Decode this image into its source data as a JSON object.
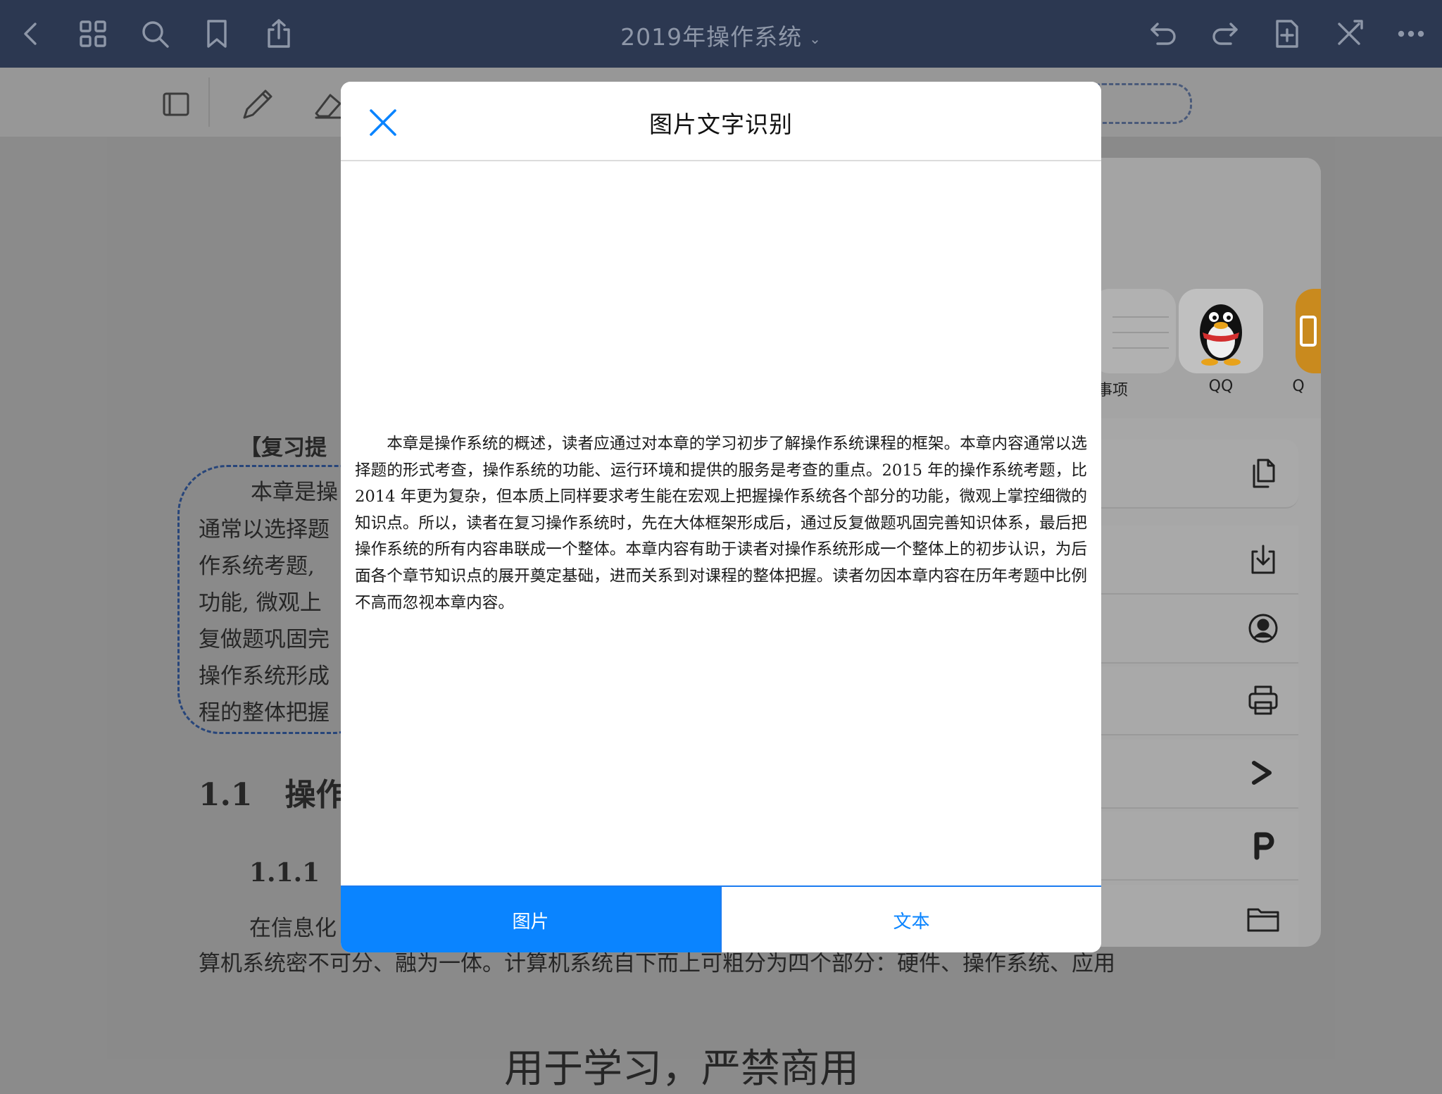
{
  "topbar": {
    "title": "2019年操作系统",
    "icons": [
      "chevron-left-icon",
      "grid-icon",
      "search-icon",
      "bookmark-icon",
      "share-icon",
      "undo-icon",
      "redo-icon",
      "add-page-icon",
      "close-tools-icon",
      "more-icon"
    ]
  },
  "toolbar": {
    "tools": [
      "page-layout-icon",
      "pencil-icon",
      "eraser-icon"
    ]
  },
  "document": {
    "heading_prompt": "【复习提",
    "lines": [
      "本章是操",
      "通常以选择题",
      "作系统考题,",
      "功能, 微观上",
      "复做题巩固完",
      "操作系统形成",
      "程的整体把握"
    ],
    "section": "1.1   操作",
    "subsection": "1.1.1",
    "para_start": "在信息化",
    "para_line2": "算机系统密不可分、融为一体。计算机系统自下而上可粗分为四个部分：硬件、操作系统、应用",
    "footer": "用于学习，严禁商用"
  },
  "share_sheet": {
    "apps": [
      {
        "label": "事项",
        "icon": "reminders-icon"
      },
      {
        "label": "QQ",
        "icon": "qq-penguin-icon"
      },
      {
        "label": "Q",
        "icon": "app-icon"
      }
    ],
    "actions": [
      "copy-icon",
      "save-icon",
      "contact-icon",
      "print-icon",
      "prompt-icon",
      "p-icon",
      "folder-icon"
    ]
  },
  "modal": {
    "title": "图片文字识别",
    "close_icon": "close-icon",
    "ocr_text": "本章是操作系统的概述，读者应通过对本章的学习初步了解操作系统课程的框架。本章内容通常以选择题的形式考查，操作系统的功能、运行环境和提供的服务是考查的重点。2015 年的操作系统考题，比 2014 年更为复杂，但本质上同样要求考生能在宏观上把握操作系统各个部分的功能，微观上掌控细微的知识点。所以，读者在复习操作系统时，先在大体框架形成后，通过反复做题巩固完善知识体系，最后把操作系统的所有内容串联成一个整体。本章内容有助于读者对操作系统形成一个整体上的初步认识，为后面各个章节知识点的展开奠定基础，进而关系到对课程的整体把握。读者勿因本章内容在历年考题中比例不高而忽视本章内容。",
    "segments": {
      "image": "图片",
      "text": "文本",
      "selected": "image"
    }
  },
  "colors": {
    "topbar": "#2c3851",
    "accent": "#0a84ff",
    "dim_overlay": "#8b8b8b"
  }
}
